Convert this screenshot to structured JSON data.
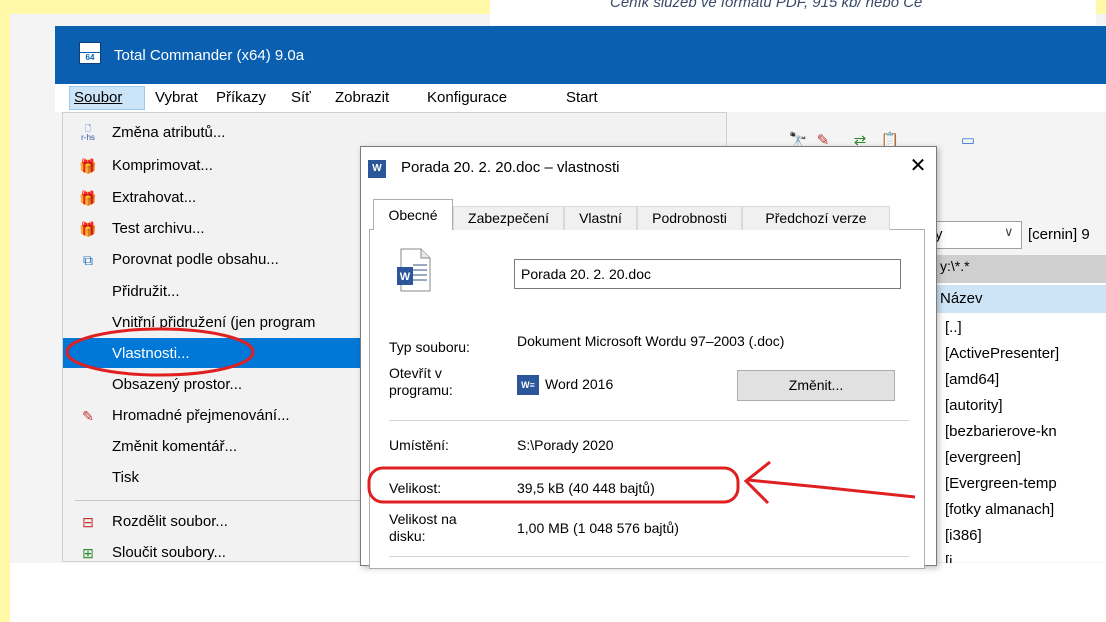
{
  "background_document": {
    "text": "Ceník služeb ve formátu PDF, 915 kb/ nebo Ce"
  },
  "app": {
    "title": "Total Commander (x64) 9.0a",
    "icon_text": "64"
  },
  "menubar": {
    "items": [
      {
        "label": "Soubor",
        "underline": "S"
      },
      {
        "label": "Vybrat",
        "underline": "V"
      },
      {
        "label": "Příkazy",
        "underline": "P"
      },
      {
        "label": "Síť",
        "underline": "S"
      },
      {
        "label": "Zobrazit",
        "underline": "Z"
      },
      {
        "label": "Konfigurace",
        "underline": "K"
      },
      {
        "label": "Start",
        "underline": "t"
      }
    ]
  },
  "file_menu": {
    "items": [
      {
        "label": "Změna atributů...",
        "icon": "attributes-icon"
      },
      {
        "label": "Komprimovat...",
        "icon": "pack-icon"
      },
      {
        "label": "Extrahovat...",
        "icon": "unpack-icon"
      },
      {
        "label": "Test archivu...",
        "icon": "test-archive-icon"
      },
      {
        "label": "Porovnat podle obsahu...",
        "icon": "compare-icon"
      },
      {
        "label": "Přidružit...",
        "icon": ""
      },
      {
        "label": "Vnitřní přidružení (jen program",
        "icon": ""
      },
      {
        "label": "Vlastnosti...",
        "icon": "",
        "selected": true
      },
      {
        "label": "Obsazený prostor...",
        "icon": ""
      },
      {
        "label": "Hromadné přejmenování...",
        "icon": "rename-icon"
      },
      {
        "label": "Změnit komentář...",
        "icon": ""
      },
      {
        "label": "Tisk",
        "icon": ""
      },
      {
        "label": "Rozdělit soubor...",
        "icon": "split-icon"
      },
      {
        "label": "Sloučit soubory...",
        "icon": "combine-icon"
      }
    ],
    "attr_icon_text": "r-hs"
  },
  "right_panel": {
    "drive_combo": "y",
    "drive_label": "[cernin]  9",
    "path": "y:\\*.*",
    "column_header": "Název",
    "files": [
      "[..]",
      "[ActivePresenter]",
      "[amd64]",
      "[autority]",
      "[bezbarierove-kn",
      "[evergreen]",
      "[Evergreen-temp",
      "[fotky almanach]",
      "[i386]",
      "[i..."
    ]
  },
  "dialog": {
    "title": "Porada 20. 2. 20.doc – vlastnosti",
    "close_glyph": "✕",
    "tabs": [
      "Obecné",
      "Zabezpečení",
      "Vlastní",
      "Podrobnosti",
      "Předchozí verze"
    ],
    "active_tab": "Obecné",
    "filename": "Porada 20. 2. 20.doc",
    "props": {
      "type_label": "Typ souboru:",
      "type_value": "Dokument Microsoft Wordu 97–2003 (.doc)",
      "opens_label": "Otevřít v programu:",
      "opens_value": "Word 2016",
      "change_button": "Změnit...",
      "location_label": "Umístění:",
      "location_value": "S:\\Porady 2020",
      "size_label": "Velikost:",
      "size_value": "39,5 kB (40 448 bajtů)",
      "disk_size_label": "Velikost na disku:",
      "disk_size_value": "1,00 MB (1 048 576 bajtů)"
    }
  },
  "annotations": {
    "circle_color": "#e02020",
    "arrow_color": "#e02020"
  },
  "colors": {
    "titlebar": "#0a5fb0",
    "highlight": "#0078d7",
    "page_margin": "#fff9a8"
  }
}
